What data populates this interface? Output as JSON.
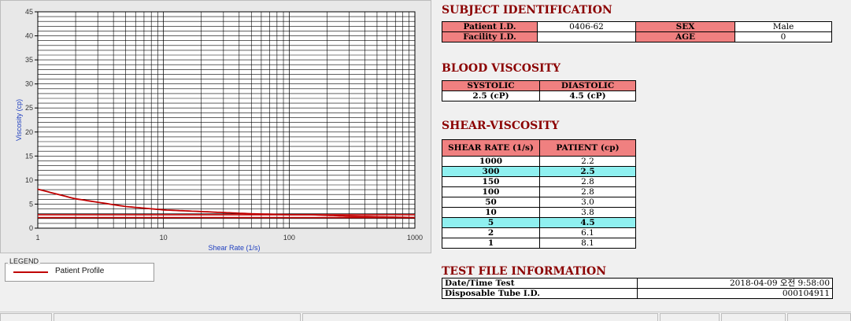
{
  "chart_data": {
    "type": "line",
    "ylabel": "Viscosity (cp)",
    "xlabel": "Shear Rate (1/s)",
    "xscale": "log",
    "xlim": [
      1,
      1000
    ],
    "ylim": [
      0,
      45
    ],
    "grid": true,
    "y_ticks": [
      "0",
      "5",
      "10",
      "15",
      "20",
      "25",
      "30",
      "35",
      "40",
      "45"
    ],
    "x_ticks": [
      "1",
      "10",
      "100",
      "1000"
    ],
    "series": [
      {
        "name": "Patient Profile",
        "color": "#c00000",
        "x": [
          1,
          2,
          5,
          10,
          50,
          100,
          150,
          300,
          1000
        ],
        "y": [
          8.1,
          6.1,
          4.5,
          3.8,
          3.0,
          2.8,
          2.8,
          2.5,
          2.2
        ]
      }
    ],
    "reference_lines": [
      {
        "color": "#c00000",
        "y": [
          2.2,
          2.8
        ]
      }
    ]
  },
  "legend": {
    "title": "LEGEND",
    "entries": [
      {
        "label": "Patient Profile",
        "color": "#c00000"
      }
    ]
  },
  "subject": {
    "title": "SUBJECT IDENTIFICATION",
    "patient_id_label": "Patient I.D.",
    "patient_id": "0406-62",
    "sex_label": "SEX",
    "sex": "Male",
    "facility_id_label": "Facility I.D.",
    "facility_id": "",
    "age_label": "AGE",
    "age": "0"
  },
  "blood": {
    "title": "BLOOD VISCOSITY",
    "systolic_label": "SYSTOLIC",
    "diastolic_label": "DIASTOLIC",
    "systolic": "2.5 (cP)",
    "diastolic": "4.5 (cP)"
  },
  "shear": {
    "title": "SHEAR-VISCOSITY",
    "col_rate": "SHEAR RATE (1/s)",
    "col_patient": "PATIENT (cp)",
    "rows": [
      {
        "rate": "1000",
        "value": "2.2"
      },
      {
        "rate": "300",
        "value": "2.5"
      },
      {
        "rate": "150",
        "value": "2.8"
      },
      {
        "rate": "100",
        "value": "2.8"
      },
      {
        "rate": "50",
        "value": "3.0"
      },
      {
        "rate": "10",
        "value": "3.8"
      },
      {
        "rate": "5",
        "value": "4.5"
      },
      {
        "rate": "2",
        "value": "6.1"
      },
      {
        "rate": "1",
        "value": "8.1"
      }
    ]
  },
  "testfile": {
    "title": "TEST FILE INFORMATION",
    "datetime_label": "Date/Time Test",
    "datetime_value": "2018-04-09  오전 9:58:00",
    "tube_label": "Disposable Tube I.D.",
    "tube_value": "000104911"
  }
}
